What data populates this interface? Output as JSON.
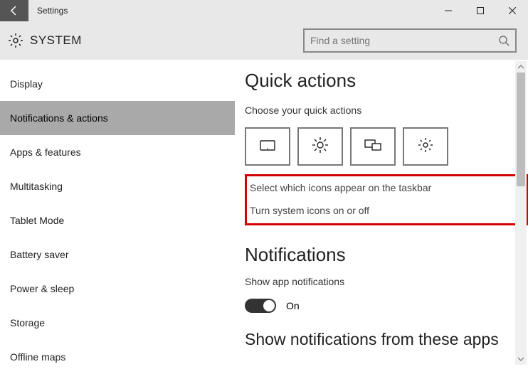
{
  "titlebar": {
    "title": "Settings"
  },
  "header": {
    "section": "SYSTEM"
  },
  "search": {
    "placeholder": "Find a setting"
  },
  "sidebar": {
    "items": [
      {
        "label": "Display"
      },
      {
        "label": "Notifications & actions"
      },
      {
        "label": "Apps & features"
      },
      {
        "label": "Multitasking"
      },
      {
        "label": "Tablet Mode"
      },
      {
        "label": "Battery saver"
      },
      {
        "label": "Power & sleep"
      },
      {
        "label": "Storage"
      },
      {
        "label": "Offline maps"
      }
    ],
    "selected_index": 1
  },
  "content": {
    "quick_actions": {
      "heading": "Quick actions",
      "subheading": "Choose your quick actions",
      "tiles": [
        "tablet-icon",
        "brightness-icon",
        "connect-icon",
        "settings-icon"
      ],
      "links": {
        "taskbar_icons": "Select which icons appear on the taskbar",
        "system_icons": "Turn system icons on or off"
      }
    },
    "notifications": {
      "heading": "Notifications",
      "show_app_label": "Show app notifications",
      "toggle_state": "On",
      "more_heading": "Show notifications from these apps"
    }
  }
}
